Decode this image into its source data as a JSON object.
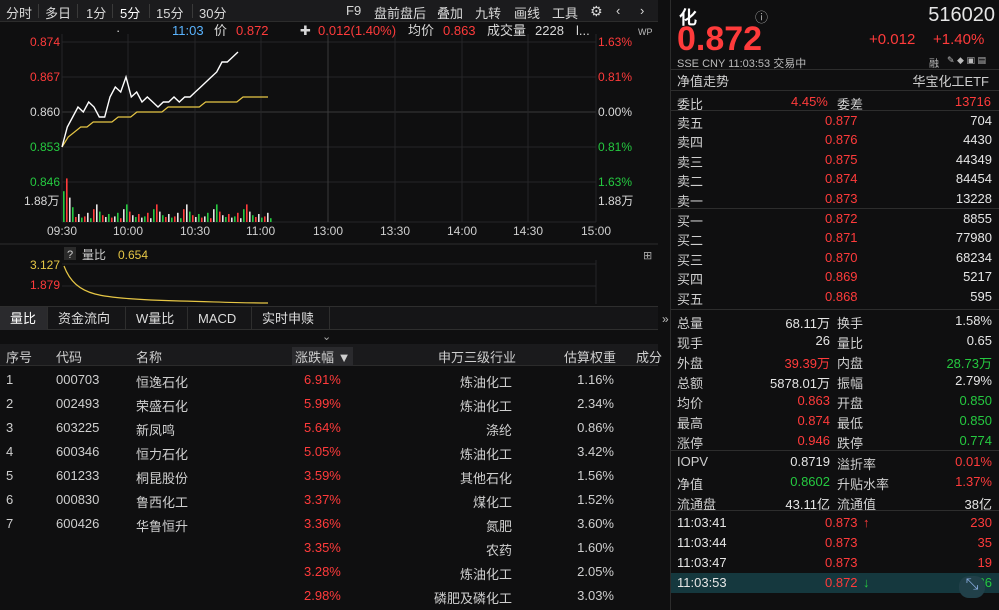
{
  "toolbar": {
    "periods": [
      "分时",
      "多日",
      "1分",
      "5分",
      "15分",
      "30分"
    ],
    "actions": [
      "F9",
      "盘前盘后",
      "叠加",
      "九转",
      "画线",
      "工具"
    ]
  },
  "info": {
    "time": "11:03",
    "price_label": "价",
    "price": "0.872",
    "change": "0.012(1.40%)",
    "avg_label": "均价",
    "avg": "0.863",
    "vol_label": "成交量",
    "vol": "2228",
    "tail": "l..."
  },
  "chart_data": [
    {
      "type": "line",
      "title": "",
      "y_left_labels": [
        "0.874",
        "0.867",
        "0.860",
        "0.853",
        "0.846"
      ],
      "y_right_labels": [
        "1.63%",
        "0.81%",
        "0.00%",
        "0.81%",
        "1.63%"
      ],
      "vol_axis_label": "1.88万",
      "x_labels": [
        "09:30",
        "10:00",
        "10:30",
        "11:00",
        "13:00",
        "13:30",
        "14:00",
        "14:30",
        "15:00"
      ],
      "ylim": [
        0.846,
        0.874
      ],
      "series": [
        {
          "values": [
            0.853,
            0.857,
            0.859,
            0.861,
            0.86,
            0.862,
            0.861,
            0.859,
            0.859,
            0.863,
            0.865,
            0.864,
            0.867,
            0.863,
            0.864,
            0.862,
            0.863,
            0.862,
            0.861,
            0.862,
            0.862,
            0.863,
            0.862,
            0.863,
            0.863,
            0.864,
            0.865,
            0.866,
            0.867,
            0.868,
            0.87,
            0.87,
            0.871,
            0.872
          ]
        },
        {
          "values": [
            0.853,
            0.855,
            0.856,
            0.857,
            0.857,
            0.858,
            0.858,
            0.858,
            0.858,
            0.859,
            0.859,
            0.859,
            0.86,
            0.86,
            0.86,
            0.86,
            0.86,
            0.861,
            0.861,
            0.861,
            0.861,
            0.861,
            0.861,
            0.862,
            0.862,
            0.862,
            0.862,
            0.862,
            0.862,
            0.863,
            0.863,
            0.863,
            0.863,
            0.863
          ]
        }
      ]
    },
    {
      "type": "line",
      "title": "",
      "indicator_name": "量比",
      "indicator_value": "0.654",
      "y_labels": [
        "3.127",
        "1.879"
      ]
    }
  ],
  "bottom_tabs": [
    "量比",
    "资金流向",
    "W量比",
    "MACD",
    "实时申赎"
  ],
  "table": {
    "headers": [
      "序号",
      "代码",
      "名称",
      "涨跌幅 ▼",
      "申万三级行业",
      "估算权重",
      "成分"
    ],
    "rows": [
      [
        "1",
        "000703",
        "恒逸石化",
        "6.91%",
        "炼油化工",
        "1.16%"
      ],
      [
        "2",
        "002493",
        "荣盛石化",
        "5.99%",
        "炼油化工",
        "2.34%"
      ],
      [
        "3",
        "603225",
        "新凤鸣",
        "5.64%",
        "涤纶",
        "0.86%"
      ],
      [
        "4",
        "600346",
        "恒力石化",
        "5.05%",
        "炼油化工",
        "3.42%"
      ],
      [
        "5",
        "601233",
        "桐昆股份",
        "3.59%",
        "其他石化",
        "1.56%"
      ],
      [
        "6",
        "000830",
        "鲁西化工",
        "3.37%",
        "煤化工",
        "1.52%"
      ],
      [
        "7",
        "600426",
        "华鲁恒升",
        "3.36%",
        "氮肥",
        "3.60%"
      ],
      [
        "",
        "",
        "",
        "3.35%",
        "农药",
        "1.60%"
      ],
      [
        "",
        "",
        "",
        "3.28%",
        "炼油化工",
        "2.05%"
      ],
      [
        "",
        "",
        "",
        "2.98%",
        "磷肥及磷化工",
        "3.03%"
      ]
    ]
  },
  "quote": {
    "name": "化",
    "code": "516020",
    "price": "0.872",
    "chg": "+0.012",
    "pct": "+1.40%",
    "meta": "SSE  CNY  11:03:53  交易中",
    "nav_label": "净值走势",
    "etf_name": "华宝化工ETF",
    "wb_label": "委比",
    "wb": "4.45%",
    "wc_label": "委差",
    "wc": "13716",
    "asks": [
      [
        "卖五",
        "0.877",
        "704"
      ],
      [
        "卖四",
        "0.876",
        "4430"
      ],
      [
        "卖三",
        "0.875",
        "44349"
      ],
      [
        "卖二",
        "0.874",
        "84454"
      ],
      [
        "卖一",
        "0.873",
        "13228"
      ]
    ],
    "bids": [
      [
        "买一",
        "0.872",
        "8855"
      ],
      [
        "买二",
        "0.871",
        "77980"
      ],
      [
        "买三",
        "0.870",
        "68234"
      ],
      [
        "买四",
        "0.869",
        "5217"
      ],
      [
        "买五",
        "0.868",
        "595"
      ]
    ],
    "stats": [
      [
        "总量",
        "68.11万",
        "换手",
        "1.58%"
      ],
      [
        "现手",
        "26",
        "量比",
        "0.65"
      ],
      [
        "外盘",
        "39.39万",
        "内盘",
        "28.73万"
      ],
      [
        "总额",
        "5878.01万",
        "振幅",
        "2.79%"
      ],
      [
        "均价",
        "0.863",
        "开盘",
        "0.850"
      ],
      [
        "最高",
        "0.874",
        "最低",
        "0.850"
      ],
      [
        "涨停",
        "0.946",
        "跌停",
        "0.774"
      ]
    ],
    "iopv": [
      [
        "IOPV",
        "0.8719",
        "溢折率",
        "0.01%"
      ],
      [
        "净值",
        "0.8602",
        "升贴水率",
        "1.37%"
      ],
      [
        "流通盘",
        "43.11亿",
        "流通值",
        "38亿"
      ]
    ],
    "ticks": [
      [
        "11:03:41",
        "0.873",
        "↑",
        "230"
      ],
      [
        "11:03:44",
        "0.873",
        "",
        "35"
      ],
      [
        "11:03:47",
        "0.873",
        "",
        "19"
      ],
      [
        "11:03:53",
        "0.872",
        "↓",
        "26"
      ]
    ]
  }
}
